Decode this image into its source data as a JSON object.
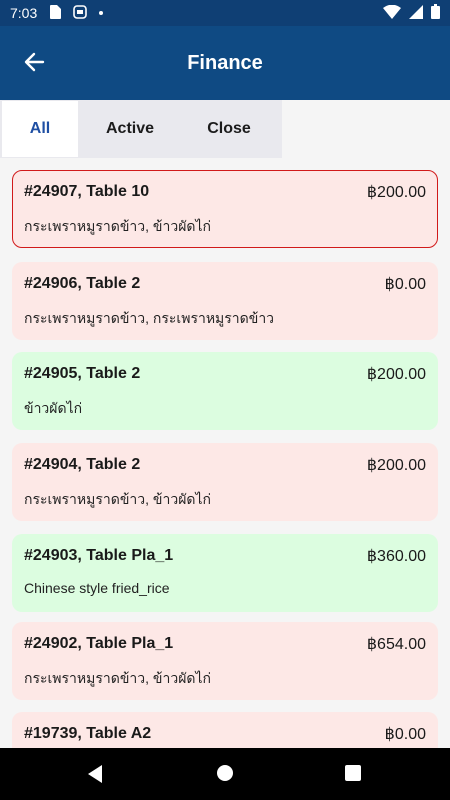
{
  "status_bar": {
    "time": "7:03",
    "icons": [
      "sim-card-icon",
      "notification-icon",
      "dot-icon",
      "wifi-icon",
      "cellular-icon",
      "battery-icon"
    ]
  },
  "app_bar": {
    "title": "Finance",
    "back_icon": "arrow-left-icon"
  },
  "tabs": [
    {
      "label": "All",
      "active": true
    },
    {
      "label": "Active",
      "active": false
    },
    {
      "label": "Close",
      "active": false
    }
  ],
  "orders": [
    {
      "title": "#24907, Table 10",
      "amount": "฿200.00",
      "items": "กระเพราหมูราดข้าว, ข้าวผัดไก่",
      "status": "unpaid",
      "selected": true
    },
    {
      "title": "#24906, Table 2",
      "amount": "฿0.00",
      "items": "กระเพราหมูราดข้าว, กระเพราหมูราดข้าว",
      "status": "unpaid",
      "selected": false
    },
    {
      "title": "#24905, Table 2",
      "amount": "฿200.00",
      "items": "ข้าวผัดไก่",
      "status": "paid",
      "selected": false
    },
    {
      "title": "#24904, Table 2",
      "amount": "฿200.00",
      "items": "กระเพราหมูราดข้าว, ข้าวผัดไก่",
      "status": "unpaid",
      "selected": false
    },
    {
      "title": "#24903, Table Pla_1",
      "amount": "฿360.00",
      "items": "Chinese style fried_rice",
      "status": "paid",
      "selected": false
    },
    {
      "title": "#24902, Table Pla_1",
      "amount": "฿654.00",
      "items": "กระเพราหมูราดข้าว, ข้าวผัดไก่",
      "status": "unpaid",
      "selected": false
    },
    {
      "title": "#19739, Table A2",
      "amount": "฿0.00",
      "items": "",
      "status": "unpaid",
      "selected": false
    }
  ],
  "colors": {
    "app_bar": "#0f4a83",
    "status_bar": "#0f3f74",
    "unpaid_card": "#fde8e6",
    "paid_card": "#dcfde0",
    "selected_border": "#d11a1a",
    "active_tab_text": "#1f4fa3"
  },
  "nav_bar": {
    "icons": [
      "back-triangle-icon",
      "home-circle-icon",
      "recents-square-icon"
    ]
  }
}
